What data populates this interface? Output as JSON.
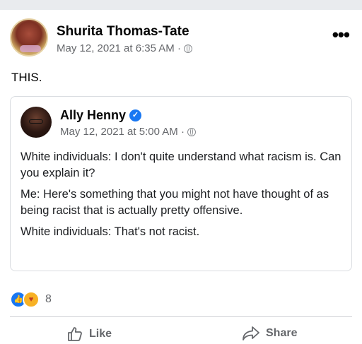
{
  "post": {
    "author": "Shurita Thomas-Tate",
    "timestamp": "May 12, 2021 at 6:35 AM · ",
    "privacy_icon": "globe-icon",
    "text": "THIS.",
    "more_label": "•••"
  },
  "shared_post": {
    "author": "Ally Henny",
    "verified_icon": "verified-badge-icon",
    "timestamp": "May 12, 2021 at 5:00 AM · ",
    "privacy_icon": "globe-icon",
    "paragraphs": [
      "White individuals: I don't quite understand what racism is. Can you explain it?",
      "Me: Here's something that you might not have thought of as being racist that is actually pretty offensive.",
      "White individuals: That's not racist."
    ]
  },
  "reactions": {
    "icons": [
      "like-icon",
      "care-icon"
    ],
    "count": "8"
  },
  "actions": {
    "like_label": "Like",
    "share_label": "Share"
  },
  "colors": {
    "brand_blue": "#1877f2",
    "meta_gray": "#65676b",
    "divider": "#ced0d4"
  }
}
